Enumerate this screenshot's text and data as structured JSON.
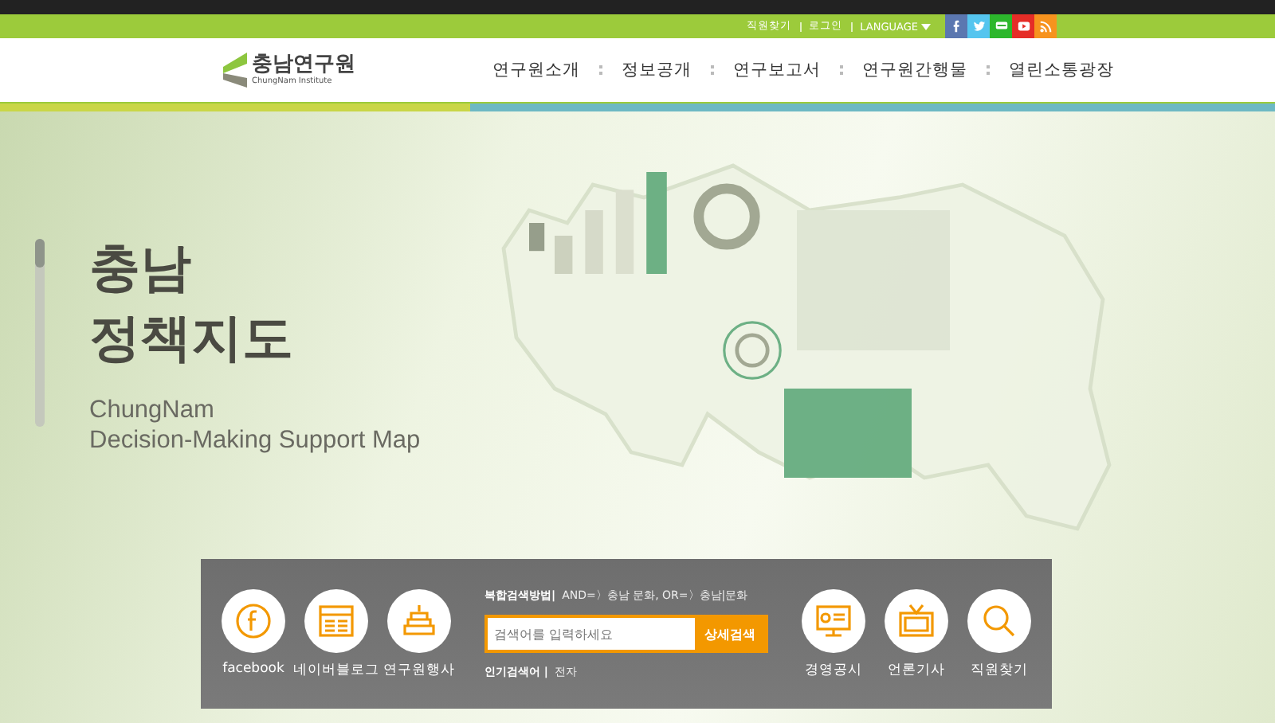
{
  "top_bar": {
    "links": [
      "직원찾기",
      "로그인"
    ],
    "language": "LANGUAGE",
    "social": [
      {
        "kind": "facebook",
        "color": "#5b77b0"
      },
      {
        "kind": "twitter",
        "color": "#55c5ef"
      },
      {
        "kind": "talk",
        "color": "#2cb72c"
      },
      {
        "kind": "video",
        "color": "#e52d27"
      },
      {
        "kind": "rss",
        "color": "#f7931e"
      }
    ]
  },
  "header": {
    "logo_name": "충남연구원",
    "logo_sub": "ChungNam Institute",
    "nav": [
      "연구원소개",
      "정보공개",
      "연구보고서",
      "연구원간행물",
      "열린소통광장"
    ]
  },
  "hero": {
    "title": [
      "충남",
      "정책지도"
    ],
    "subtitle": [
      "ChungNam",
      "Decision-Making Support Map"
    ],
    "slider": {
      "level": 0.15
    }
  },
  "panel": {
    "left_links": [
      {
        "kind": "facebook",
        "label": "facebook"
      },
      {
        "kind": "blog",
        "label": "네이버블로그"
      },
      {
        "kind": "cake",
        "label": "연구원행사"
      }
    ],
    "search": {
      "help_label": "복합검색방법|",
      "help_text": "AND=〉충남 문화, OR=〉충남|문화",
      "placeholder": "검색어를 입력하세요",
      "button": "상세검색",
      "popular_label": "인기검색어 |",
      "popular": [
        "전자"
      ]
    },
    "right_links": [
      {
        "kind": "monitor",
        "label": "경영공시"
      },
      {
        "kind": "tv",
        "label": "언론기사"
      },
      {
        "kind": "search",
        "label": "직원찾기"
      }
    ]
  }
}
